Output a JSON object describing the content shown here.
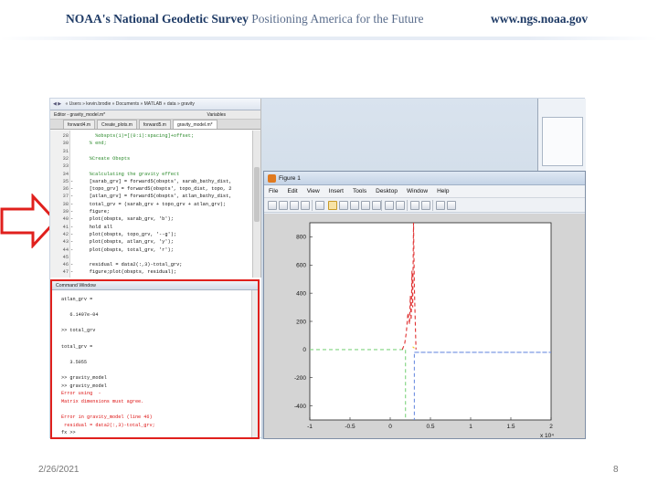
{
  "header": {
    "agency_prefix": "NOAA's",
    "agency_name": "National Geodetic Survey",
    "tagline": "Positioning America for the Future",
    "url": "www.ngs.noaa.gov"
  },
  "editor": {
    "breadcrumb": "« Users » kevin.brodie » Documents » MATLAB » data » gravity",
    "window_title": "Editor - gravity_model.m*",
    "variables_tab": "Variables",
    "tabs": [
      "forward4.m",
      "Create_plots.m",
      "forward5.m",
      "gravity_model.m*"
    ],
    "lines": [
      {
        "n": "28",
        "dash": "",
        "text": "      %obspts(1)=[(0:1):spacing]+offset;",
        "kind": "cmt"
      },
      {
        "n": "30",
        "dash": "",
        "text": "    % end;",
        "kind": "cmt"
      },
      {
        "n": "31",
        "dash": "",
        "text": "",
        "kind": "code"
      },
      {
        "n": "32",
        "dash": "",
        "text": "    %Create Obspts",
        "kind": "cmt"
      },
      {
        "n": "33",
        "dash": "",
        "text": "",
        "kind": "code"
      },
      {
        "n": "34",
        "dash": "",
        "text": "    %calculating the gravity effect",
        "kind": "cmt"
      },
      {
        "n": "35",
        "dash": "-",
        "text": "    [sarab_grv] = forward5(obspts', sarab_bathy_dist,",
        "kind": "code"
      },
      {
        "n": "36",
        "dash": "-",
        "text": "    [topo_grv] = forward5(obspts', topo_dist, topo, 2",
        "kind": "code"
      },
      {
        "n": "37",
        "dash": "-",
        "text": "    [atlan_grv] = forward5(obspts', atlan_bathy_dist,",
        "kind": "code"
      },
      {
        "n": "38",
        "dash": "-",
        "text": "    total_grv = (sarab_grv + topo_grv + atlan_grv);",
        "kind": "code"
      },
      {
        "n": "39",
        "dash": "-",
        "text": "    figure;",
        "kind": "code"
      },
      {
        "n": "40",
        "dash": "-",
        "text": "    plot(obspts, sarab_grv, 'b');",
        "kind": "code"
      },
      {
        "n": "41",
        "dash": "-",
        "text": "    hold all",
        "kind": "code"
      },
      {
        "n": "42",
        "dash": "-",
        "text": "    plot(obspts, topo_grv, '--g');",
        "kind": "code"
      },
      {
        "n": "43",
        "dash": "-",
        "text": "    plot(obspts, atlan_grv, 'y');",
        "kind": "code"
      },
      {
        "n": "44",
        "dash": "-",
        "text": "    plot(obspts, total_grv, 'r');",
        "kind": "code"
      },
      {
        "n": "45",
        "dash": "",
        "text": "",
        "kind": "code"
      },
      {
        "n": "46",
        "dash": "-",
        "text": "    residual = data2(:,3)-total_grv;",
        "kind": "code"
      },
      {
        "n": "47",
        "dash": "-",
        "text": "    figure;plot(obspts, residual);",
        "kind": "code"
      }
    ]
  },
  "command_window": {
    "title": "Command Window",
    "lines": [
      {
        "text": "atlan_grv =",
        "kind": "out"
      },
      {
        "text": "",
        "kind": "out"
      },
      {
        "text": "   6.1497e-04",
        "kind": "out"
      },
      {
        "text": "",
        "kind": "out"
      },
      {
        "text": ">> total_grv",
        "kind": "out"
      },
      {
        "text": "",
        "kind": "out"
      },
      {
        "text": "total_grv =",
        "kind": "out"
      },
      {
        "text": "",
        "kind": "out"
      },
      {
        "text": "   3.5055",
        "kind": "out"
      },
      {
        "text": "",
        "kind": "out"
      },
      {
        "text": ">> gravity_model",
        "kind": "out"
      },
      {
        "text": ">> gravity_model",
        "kind": "out"
      },
      {
        "text": "Error using  - ",
        "kind": "err"
      },
      {
        "text": "Matrix dimensions must agree.",
        "kind": "err"
      },
      {
        "text": "",
        "kind": "out"
      },
      {
        "text": "Error in gravity_model (line 46)",
        "kind": "err"
      },
      {
        "text": " residual = data2(:,3)-total_grv;",
        "kind": "err"
      },
      {
        "text": "fx >>",
        "kind": "out"
      }
    ]
  },
  "figure_window": {
    "title": "Figure 1",
    "menus": [
      "File",
      "Edit",
      "View",
      "Insert",
      "Tools",
      "Desktop",
      "Window",
      "Help"
    ],
    "toolbar_icons": [
      "new-figure-icon",
      "open-icon",
      "save-icon",
      "print-icon",
      "edit-plot-icon",
      "zoom-in-icon",
      "zoom-out-icon",
      "pan-icon",
      "rotate-icon",
      "data-cursor-icon",
      "brush-icon",
      "link-icon",
      "colorbar-icon",
      "legend-icon",
      "hide-plot-tools-icon",
      "show-plot-tools-icon"
    ]
  },
  "chart_data": {
    "type": "line",
    "title": "",
    "xlabel": "",
    "ylabel": "",
    "x_exponent_label": "x 10⁴",
    "xlim": [
      -1,
      2
    ],
    "ylim": [
      -500,
      900
    ],
    "xticks": [
      "-1",
      "-0.5",
      "0",
      "0.5",
      "1",
      "1.5",
      "2"
    ],
    "yticks": [
      "800",
      "600",
      "400",
      "200",
      "0",
      "-200",
      "-400"
    ],
    "grid": false,
    "legend": "none",
    "series": [
      {
        "color": "#6e8ee0",
        "style": "dashed",
        "x": [
          0.3,
          2.0,
          0.3,
          0.3
        ],
        "y": [
          -20,
          -20,
          -20,
          -500
        ]
      },
      {
        "color": "#7fd47f",
        "style": "dashed",
        "x": [
          -1.0,
          0.19,
          0.19,
          0.19
        ],
        "y": [
          0,
          0,
          0,
          -500
        ]
      },
      {
        "color": "#e03030",
        "style": "dashed",
        "x": [
          0.15,
          0.18,
          0.2,
          0.22,
          0.24,
          0.25,
          0.26,
          0.27,
          0.28,
          0.29,
          0.3,
          0.31,
          0.32
        ],
        "y": [
          0,
          40,
          120,
          260,
          180,
          380,
          210,
          560,
          300,
          900,
          450,
          220,
          0
        ]
      },
      {
        "color": "#f0c820",
        "style": "dashed",
        "x": [
          0.28,
          0.3
        ],
        "y": [
          20,
          10
        ]
      }
    ]
  },
  "footer": {
    "date": "2/26/2021",
    "page": "8"
  },
  "colors": {
    "highlight_border": "#e0201d",
    "arrow": "#e0201d",
    "header_text": "#1f3b66"
  }
}
